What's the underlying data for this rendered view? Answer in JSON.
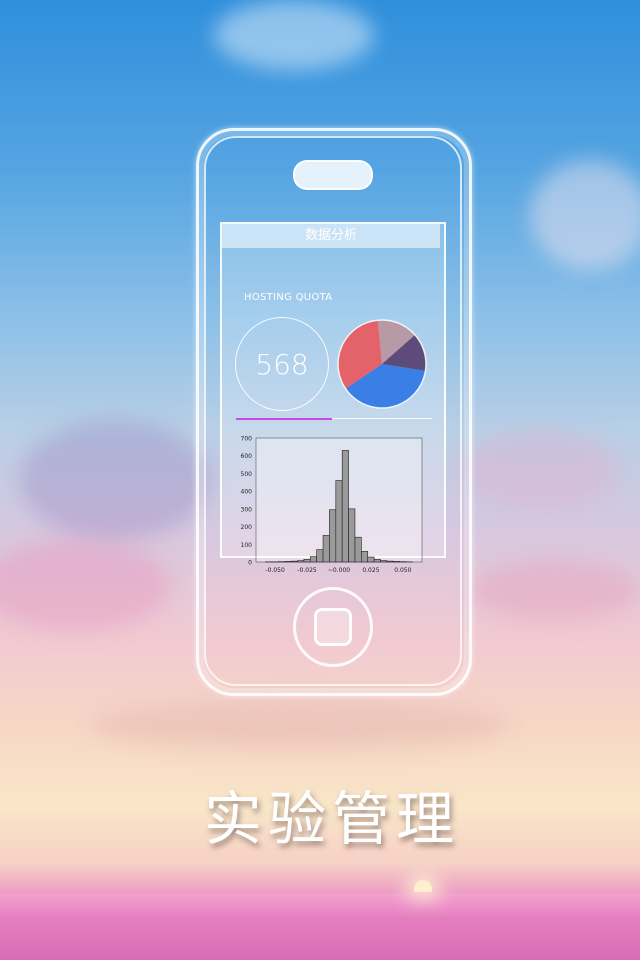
{
  "screen": {
    "nav_title": "数据分析",
    "quota_label": "HOSTING QUOTA",
    "quota_value": "568"
  },
  "pie": {
    "slices": [
      {
        "name": "blue",
        "value": 38,
        "color": "#3a7fe6"
      },
      {
        "name": "red",
        "value": 33,
        "color": "#e4636a"
      },
      {
        "name": "mauve",
        "value": 15,
        "color": "#b79aa6"
      },
      {
        "name": "purple",
        "value": 14,
        "color": "#5d4b7b"
      }
    ]
  },
  "progress": {
    "value": 0.49,
    "color": "#c64be0"
  },
  "chart_data": {
    "type": "bar",
    "x": [
      -0.055,
      -0.05,
      -0.045,
      -0.04,
      -0.035,
      -0.03,
      -0.025,
      -0.02,
      -0.015,
      -0.01,
      -0.005,
      0.0,
      0.005,
      0.01,
      0.015,
      0.02,
      0.025,
      0.03,
      0.035,
      0.04,
      0.045,
      0.05,
      0.055
    ],
    "values": [
      1,
      1,
      2,
      3,
      5,
      8,
      15,
      30,
      70,
      150,
      295,
      460,
      630,
      300,
      140,
      60,
      28,
      15,
      8,
      5,
      3,
      2,
      1
    ],
    "ylim": [
      0,
      700
    ],
    "xlim": [
      -0.065,
      0.065
    ],
    "yticks": [
      "0",
      "100",
      "200",
      "300",
      "400",
      "500",
      "600",
      "700"
    ],
    "xticks": [
      "-0.050",
      "-0.025",
      "~0.000",
      "0.025",
      "0.050"
    ],
    "xtick_values": [
      -0.05,
      -0.025,
      0.0,
      0.025,
      0.05
    ]
  },
  "title": "实验管理"
}
